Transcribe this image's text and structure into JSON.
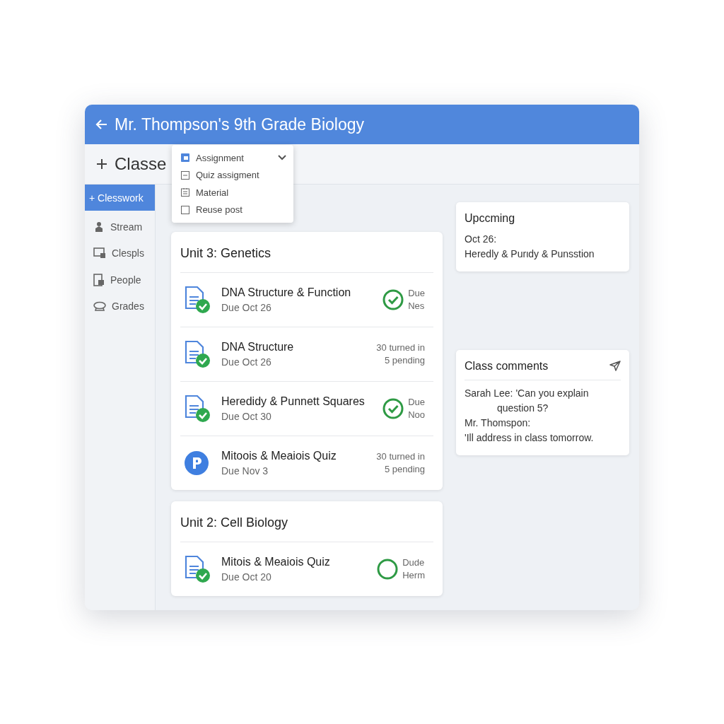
{
  "window": {
    "title": "Mr. Thompson's 9th Grade Biology"
  },
  "toolbar": {
    "create_label": "Classe"
  },
  "create_menu": [
    {
      "label": "Assignment",
      "kind": "assignment",
      "expander": true
    },
    {
      "label": "Quiz assigment",
      "kind": "quiz",
      "expander": false
    },
    {
      "label": "Material",
      "kind": "material",
      "expander": false
    },
    {
      "label": "Reuse post",
      "kind": "reuse",
      "expander": false
    }
  ],
  "sidebar": {
    "items": [
      {
        "label": "+ Clesswork",
        "kind": "plain",
        "selected": true
      },
      {
        "label": "Stream",
        "kind": "stream",
        "selected": false
      },
      {
        "label": "Clespls",
        "kind": "classes",
        "selected": false
      },
      {
        "label": "People",
        "kind": "people",
        "selected": false
      },
      {
        "label": "Grades",
        "kind": "grades",
        "selected": false
      }
    ]
  },
  "units": [
    {
      "title": "Unit 3: Genetics",
      "items": [
        {
          "title": "DNA Structure & Function",
          "due": "Due Oct 26",
          "kind": "doc",
          "status": {
            "kind": "check",
            "lines": [
              "Due",
              "Nes"
            ]
          }
        },
        {
          "title": "DNA Structure",
          "due": "Due Oct 26",
          "kind": "doc",
          "status": {
            "kind": "counts",
            "lines": [
              "30 turned in",
              "5 pending"
            ]
          }
        },
        {
          "title": "Heredidy & Punnett Squares",
          "due": "Due Oct 30",
          "kind": "doc",
          "status": {
            "kind": "check",
            "lines": [
              "Due",
              "Noo"
            ]
          }
        },
        {
          "title": "Mitoois & Meaiois Quiz",
          "due": "Due Nov 3",
          "kind": "quiz",
          "status": {
            "kind": "counts",
            "lines": [
              "30 turned in",
              "5 pending"
            ]
          }
        }
      ]
    },
    {
      "title": "Unit 2: Cell Biology",
      "items": [
        {
          "title": "Mitois & Meaiois Quiz",
          "due": "Due Oct 20",
          "kind": "doc",
          "status": {
            "kind": "ring",
            "lines": [
              "Dude",
              "Herm"
            ]
          }
        }
      ]
    }
  ],
  "upcoming": {
    "title": "Upccming",
    "date": "Oct 26:",
    "text": "Heredly & Purιdy & Punsstion"
  },
  "comments": {
    "title": "Class comments",
    "lines": [
      {
        "text": "Sarah Lee: 'Can you explain",
        "indented": false
      },
      {
        "text": "question 5?",
        "indented": true
      },
      {
        "text": "Mr. Thomspon:",
        "indented": false
      },
      {
        "text": "'Ill address in class tomorrow.",
        "indented": false
      }
    ]
  }
}
